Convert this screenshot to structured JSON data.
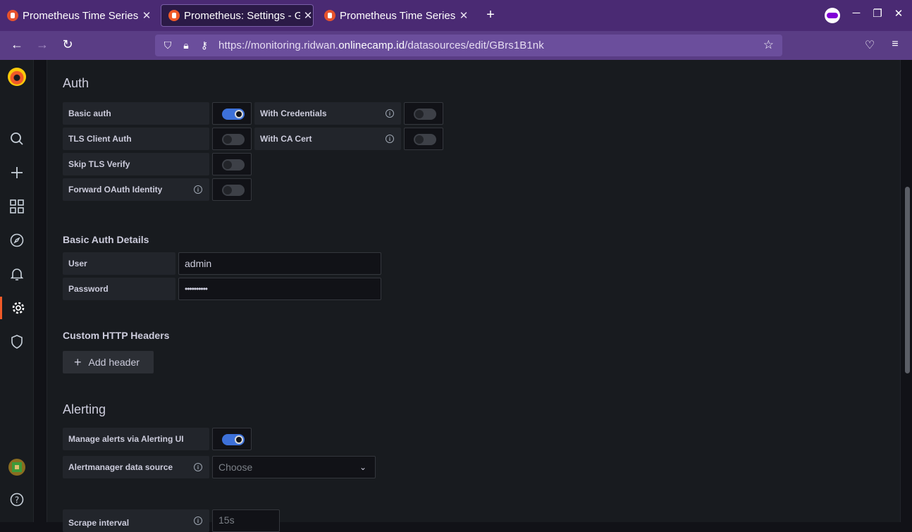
{
  "browser": {
    "tabs": [
      {
        "title": "Prometheus Time Series",
        "active": false
      },
      {
        "title": "Prometheus: Settings - Gr",
        "active": true
      },
      {
        "title": "Prometheus Time Series",
        "active": false
      }
    ],
    "url_prefix": "https://monitoring.ridwan.",
    "url_domain": "onlinecamp.id",
    "url_path": "/datasources/edit/GBrs1B1nk"
  },
  "auth": {
    "heading": "Auth",
    "basic_auth": {
      "label": "Basic auth",
      "on": true
    },
    "with_credentials": {
      "label": "With Credentials",
      "on": false
    },
    "tls_client_auth": {
      "label": "TLS Client Auth",
      "on": false
    },
    "with_ca_cert": {
      "label": "With CA Cert",
      "on": false
    },
    "skip_tls_verify": {
      "label": "Skip TLS Verify",
      "on": false
    },
    "forward_oauth": {
      "label": "Forward OAuth Identity",
      "on": false
    }
  },
  "basic_auth_details": {
    "heading": "Basic Auth Details",
    "user_label": "User",
    "user_value": "admin",
    "password_label": "Password",
    "password_value": "••••••••••"
  },
  "custom_headers": {
    "heading": "Custom HTTP Headers",
    "add_button": "Add header"
  },
  "alerting": {
    "heading": "Alerting",
    "manage_alerts": {
      "label": "Manage alerts via Alerting UI",
      "on": true
    },
    "alertmanager_label": "Alertmanager data source",
    "alertmanager_placeholder": "Choose",
    "scrape_label": "Scrape interval",
    "scrape_placeholder": "15s"
  }
}
